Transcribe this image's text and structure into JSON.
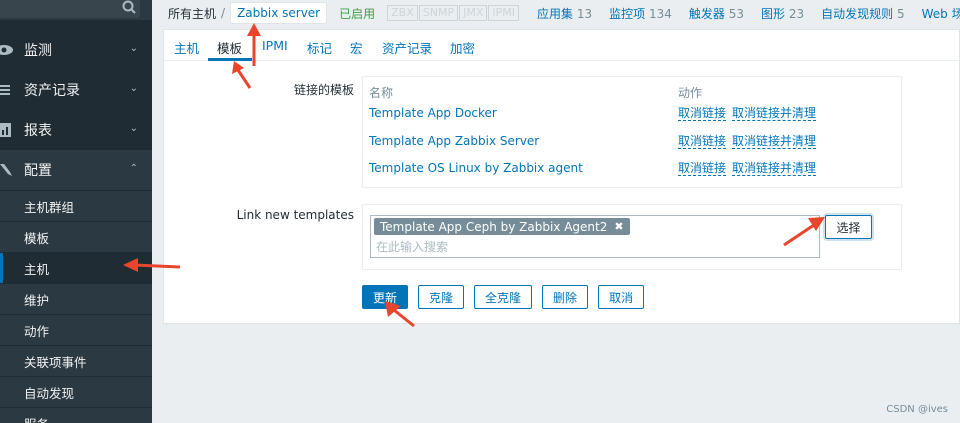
{
  "sidebar": {
    "menu": [
      {
        "label": "监测",
        "icon": "eye-icon",
        "chevron": "⌄"
      },
      {
        "label": "资产记录",
        "icon": "list-icon",
        "chevron": "⌄"
      },
      {
        "label": "报表",
        "icon": "bar-chart-icon",
        "chevron": "⌄"
      },
      {
        "label": "配置",
        "icon": "wrench-icon",
        "chevron": "⌃"
      }
    ],
    "submenu": [
      "主机群组",
      "模板",
      "主机",
      "维护",
      "动作",
      "关联项事件",
      "自动发现",
      "服务"
    ]
  },
  "breadcrumb": {
    "all_hosts": "所有主机",
    "separator": "/",
    "current": "Zabbix server",
    "status": "已启用",
    "availability": [
      "ZBX",
      "SNMP",
      "JMX",
      "IPMI"
    ],
    "links": [
      {
        "label": "应用集",
        "count": "13"
      },
      {
        "label": "监控项",
        "count": "134"
      },
      {
        "label": "触发器",
        "count": "53"
      },
      {
        "label": "图形",
        "count": "23"
      },
      {
        "label": "自动发现规则",
        "count": "5"
      },
      {
        "label": "Web 场景",
        "count": ""
      }
    ]
  },
  "tabs": [
    "主机",
    "模板",
    "IPMI",
    "标记",
    "宏",
    "资产记录",
    "加密"
  ],
  "linked_templates": {
    "label": "链接的模板",
    "col_name": "名称",
    "col_action": "动作",
    "rows": [
      {
        "name": "Template App Docker",
        "unlink": "取消链接",
        "unlink_clear": "取消链接并清理"
      },
      {
        "name": "Template App Zabbix Server",
        "unlink": "取消链接",
        "unlink_clear": "取消链接并清理"
      },
      {
        "name": "Template OS Linux by Zabbix agent",
        "unlink": "取消链接",
        "unlink_clear": "取消链接并清理"
      }
    ]
  },
  "new_templates": {
    "label": "Link new templates",
    "chip": "Template App Ceph by Zabbix Agent2",
    "chip_remove": "✖",
    "placeholder": "在此输入搜索",
    "select_button": "选择"
  },
  "buttons": {
    "update": "更新",
    "clone": "克隆",
    "full_clone": "全克隆",
    "delete": "删除",
    "cancel": "取消"
  },
  "colors": {
    "accent": "#0275b8",
    "sidebar": "#1f2c33",
    "annotation_arrow": "#e8452c",
    "enabled": "#429e47"
  },
  "watermark": "CSDN @ives"
}
